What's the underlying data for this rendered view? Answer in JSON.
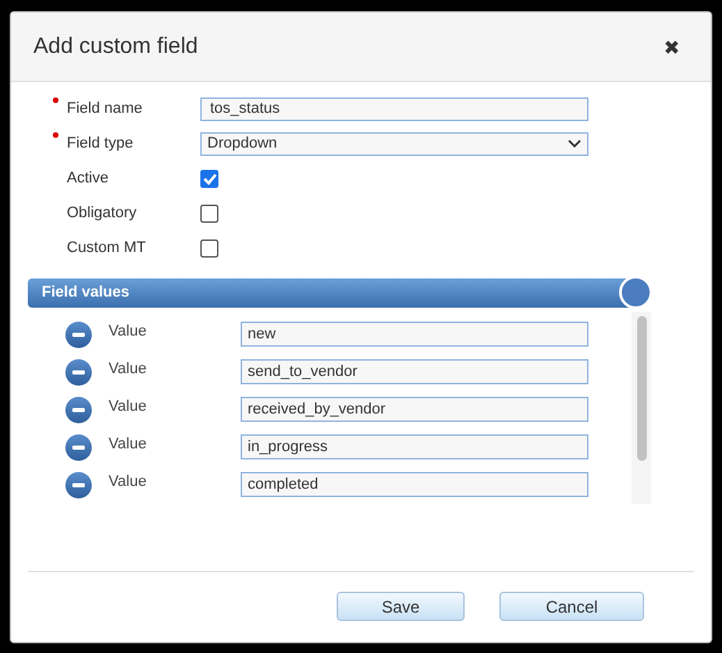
{
  "dialog": {
    "title": "Add custom field",
    "close": "✖"
  },
  "fields": [
    {
      "kind": "text",
      "label": "Field name",
      "required": true,
      "value": "tos_status"
    },
    {
      "kind": "select",
      "label": "Field type",
      "required": true,
      "value": "Dropdown"
    },
    {
      "kind": "checkbox",
      "label": "Active",
      "checked": true
    },
    {
      "kind": "checkbox",
      "label": "Obligatory",
      "checked": false
    },
    {
      "kind": "checkbox",
      "label": "Custom MT",
      "checked": false
    }
  ],
  "field_values": {
    "title": "Field values",
    "rows": [
      {
        "label": "Value",
        "value": "new"
      },
      {
        "label": "Value",
        "value": "send_to_vendor"
      },
      {
        "label": "Value",
        "value": "received_by_vendor"
      },
      {
        "label": "Value",
        "value": "in_progress"
      },
      {
        "label": "Value",
        "value": "completed"
      }
    ]
  },
  "buttons": [
    "Save",
    "Cancel"
  ]
}
